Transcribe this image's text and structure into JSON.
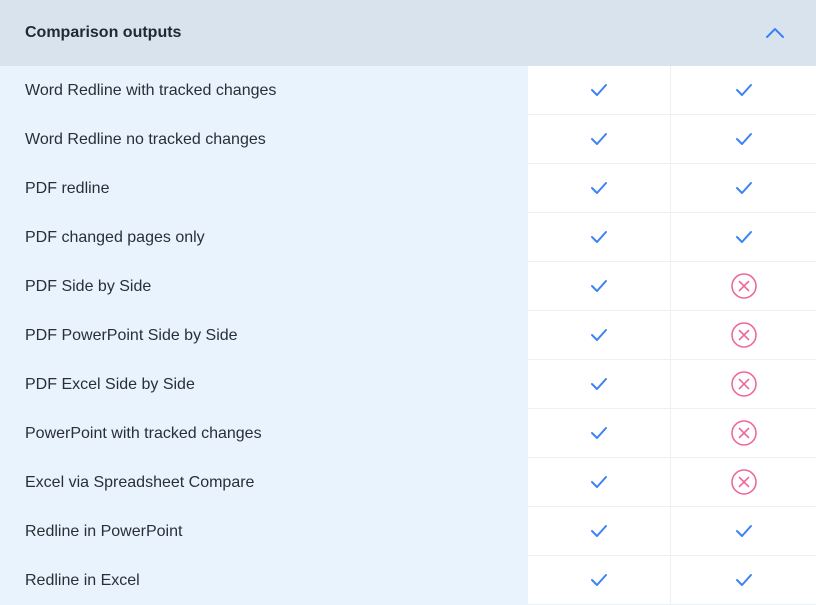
{
  "header": {
    "title": "Comparison outputs",
    "toggle_icon": "chevron-up-icon"
  },
  "colors": {
    "header_bg": "#d9e3ee",
    "label_bg": "#e8f3fe",
    "check": "#3b82f6",
    "cross": "#ec6a9b"
  },
  "rows": [
    {
      "label": "Word Redline with tracked changes",
      "values": [
        "check",
        "check"
      ]
    },
    {
      "label": "Word Redline no tracked changes",
      "values": [
        "check",
        "check"
      ]
    },
    {
      "label": "PDF redline",
      "values": [
        "check",
        "check"
      ]
    },
    {
      "label": "PDF changed pages only",
      "values": [
        "check",
        "check"
      ]
    },
    {
      "label": "PDF Side by Side",
      "values": [
        "check",
        "cross"
      ]
    },
    {
      "label": "PDF PowerPoint Side by Side",
      "values": [
        "check",
        "cross"
      ]
    },
    {
      "label": "PDF Excel Side by Side",
      "values": [
        "check",
        "cross"
      ]
    },
    {
      "label": "PowerPoint with tracked changes",
      "values": [
        "check",
        "cross"
      ]
    },
    {
      "label": "Excel via Spreadsheet Compare",
      "values": [
        "check",
        "cross"
      ]
    },
    {
      "label": "Redline in PowerPoint",
      "values": [
        "check",
        "check"
      ]
    },
    {
      "label": "Redline in Excel",
      "values": [
        "check",
        "check"
      ]
    }
  ]
}
